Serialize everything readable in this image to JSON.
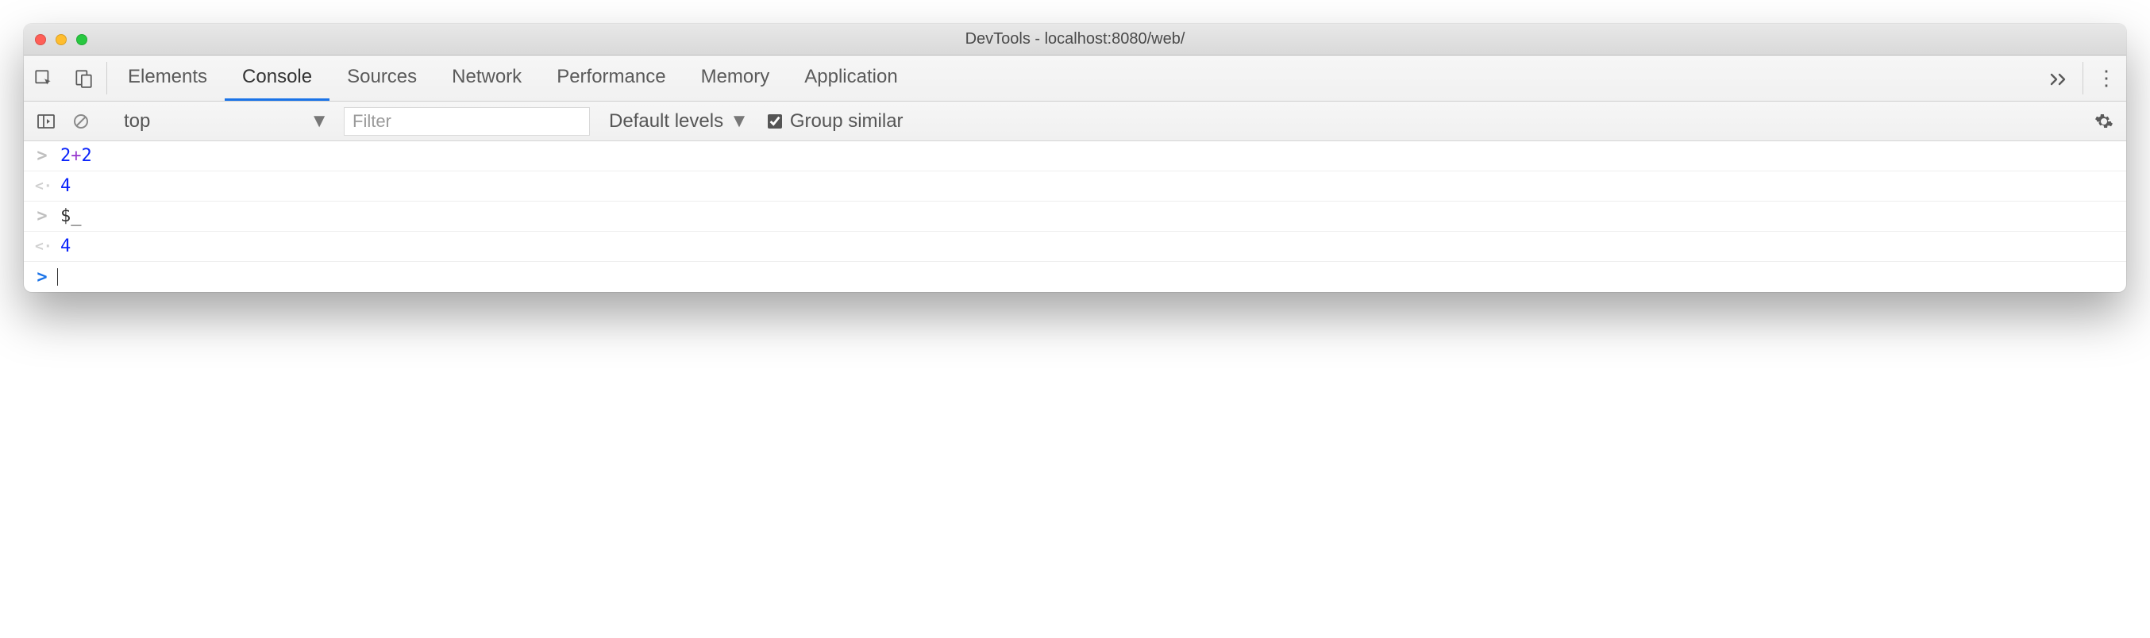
{
  "window": {
    "title": "DevTools - localhost:8080/web/"
  },
  "tabs": {
    "items": [
      "Elements",
      "Console",
      "Sources",
      "Network",
      "Performance",
      "Memory",
      "Application"
    ],
    "active_index": 1
  },
  "subbar": {
    "context": "top",
    "filter_placeholder": "Filter",
    "levels_label": "Default levels",
    "group_similar_label": "Group similar",
    "group_similar_checked": true
  },
  "console": {
    "rows": [
      {
        "kind": "input",
        "marker": ">",
        "text_parts": [
          "2",
          "+",
          "2"
        ]
      },
      {
        "kind": "output",
        "marker": "<·",
        "text": "4"
      },
      {
        "kind": "input",
        "marker": ">",
        "text": "$_"
      },
      {
        "kind": "output",
        "marker": "<·",
        "text": "4"
      }
    ],
    "prompt_marker": ">"
  }
}
